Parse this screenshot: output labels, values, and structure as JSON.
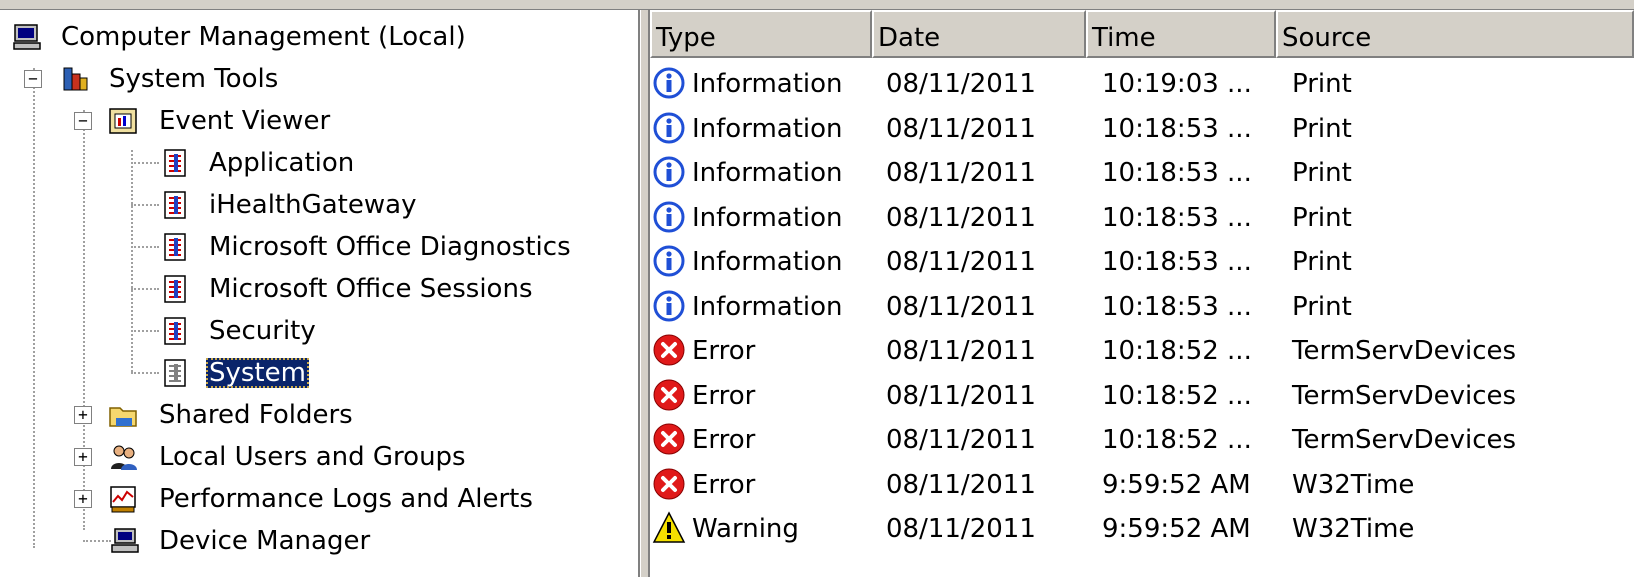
{
  "tree": {
    "root": {
      "label": "Computer Management (Local)",
      "icon": "computer-icon"
    },
    "items": [
      {
        "label": "System Tools",
        "icon": "toolbox-icon",
        "expander": "−"
      },
      {
        "label": "Event Viewer",
        "icon": "event-viewer-icon",
        "expander": "−"
      },
      {
        "label": "Application",
        "icon": "event-log-icon"
      },
      {
        "label": "iHealthGateway",
        "icon": "event-log-icon"
      },
      {
        "label": "Microsoft Office Diagnostics",
        "icon": "event-log-icon"
      },
      {
        "label": "Microsoft Office Sessions",
        "icon": "event-log-icon"
      },
      {
        "label": "Security",
        "icon": "event-log-icon"
      },
      {
        "label": "System",
        "icon": "event-log-icon",
        "selected": true
      },
      {
        "label": "Shared Folders",
        "icon": "folder-icon",
        "expander": "+"
      },
      {
        "label": "Local Users and Groups",
        "icon": "users-icon",
        "expander": "+"
      },
      {
        "label": "Performance Logs and Alerts",
        "icon": "performance-icon",
        "expander": "+"
      },
      {
        "label": "Device Manager",
        "icon": "device-manager-icon"
      }
    ]
  },
  "list": {
    "columns": [
      "Type",
      "Date",
      "Time",
      "Source"
    ],
    "rows": [
      {
        "type": "Information",
        "date": "08/11/2011",
        "time": "10:19:03 ...",
        "source": "Print"
      },
      {
        "type": "Information",
        "date": "08/11/2011",
        "time": "10:18:53 ...",
        "source": "Print"
      },
      {
        "type": "Information",
        "date": "08/11/2011",
        "time": "10:18:53 ...",
        "source": "Print"
      },
      {
        "type": "Information",
        "date": "08/11/2011",
        "time": "10:18:53 ...",
        "source": "Print"
      },
      {
        "type": "Information",
        "date": "08/11/2011",
        "time": "10:18:53 ...",
        "source": "Print"
      },
      {
        "type": "Information",
        "date": "08/11/2011",
        "time": "10:18:53 ...",
        "source": "Print"
      },
      {
        "type": "Error",
        "date": "08/11/2011",
        "time": "10:18:52 ...",
        "source": "TermServDevices"
      },
      {
        "type": "Error",
        "date": "08/11/2011",
        "time": "10:18:52 ...",
        "source": "TermServDevices"
      },
      {
        "type": "Error",
        "date": "08/11/2011",
        "time": "10:18:52 ...",
        "source": "TermServDevices"
      },
      {
        "type": "Error",
        "date": "08/11/2011",
        "time": "9:59:52 AM",
        "source": "W32Time"
      },
      {
        "type": "Warning",
        "date": "08/11/2011",
        "time": "9:59:52 AM",
        "source": "W32Time"
      }
    ]
  },
  "colors": {
    "selection": "#0a246a",
    "info": "#1f4fd6",
    "error": "#e01919",
    "warning": "#f4e000",
    "chrome": "#d4d0c8"
  }
}
